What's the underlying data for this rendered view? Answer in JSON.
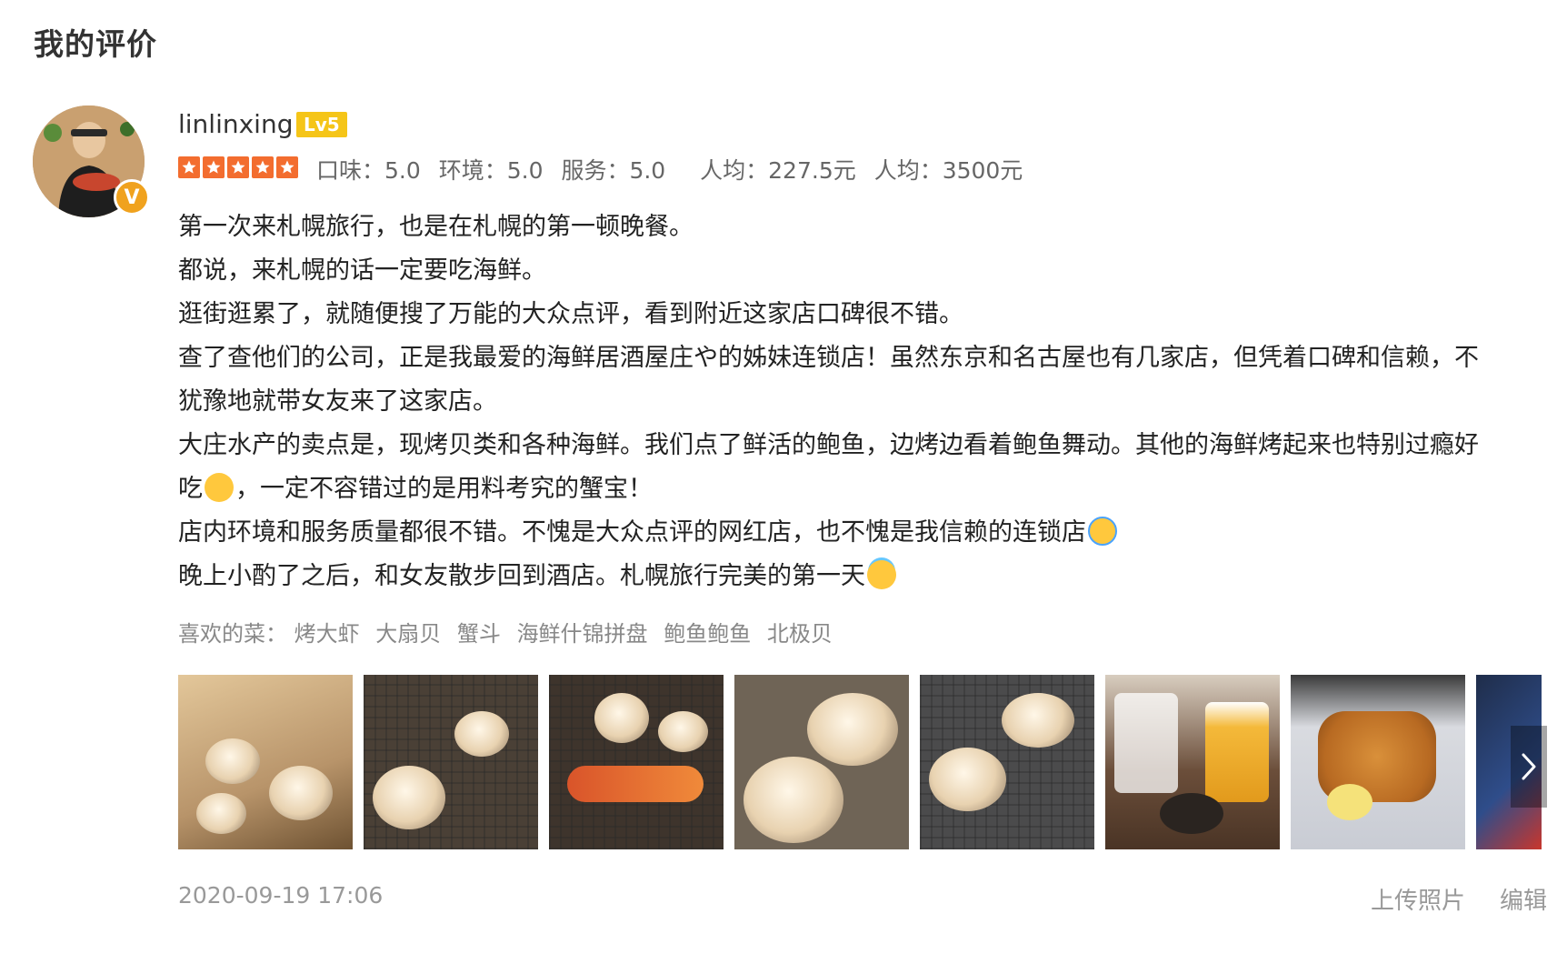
{
  "header": {
    "title": "我的评价"
  },
  "user": {
    "name": "linlinxing",
    "level": "Lv5",
    "verified_badge": "V"
  },
  "rating": {
    "stars": 5,
    "scores": [
      {
        "label": "口味：5.0"
      },
      {
        "label": "环境：5.0"
      },
      {
        "label": "服务：5.0"
      },
      {
        "label": "人均：227.5元"
      },
      {
        "label": "人均：3500元"
      }
    ]
  },
  "review": {
    "lines": [
      "第一次来札幌旅行，也是在札幌的第一顿晚餐。",
      "都说，来札幌的话一定要吃海鲜。",
      "逛街逛累了，就随便搜了万能的大众点评，看到附近这家店口碑很不错。",
      "查了查他们的公司，正是我最爱的海鲜居酒屋庄や的姊妹连锁店！虽然东京和名古屋也有几家店，但凭着口碑和信赖，不",
      "犹豫地就带女友来了这家店。",
      "大庄水产的卖点是，现烤贝类和各种海鲜。我们点了鲜活的鲍鱼，边烤边看着鲍鱼舞动。其他的海鲜烤起来也特别过瘾好",
      "吃",
      "，一定不容错过的是用料考究的蟹宝！",
      "店内环境和服务质量都很不错。不愧是大众点评的网红店，也不愧是我信赖的连锁店",
      "晚上小酌了之后，和女友散步回到酒店。札幌旅行完美的第一天"
    ]
  },
  "favorites": {
    "label": "喜欢的菜：",
    "dishes": [
      "烤大虾",
      "大扇贝",
      "蟹斗",
      "海鲜什锦拼盘",
      "鲍鱼鲍鱼",
      "北极贝"
    ]
  },
  "photos": {
    "icons": {
      "next": "chevron-right-icon"
    },
    "colors": [
      "#b8946a",
      "#6f6456",
      "#8a6a50",
      "#a59684",
      "#6c6d6e",
      "#6b4e3a",
      "#d9dbe0"
    ]
  },
  "footer": {
    "timestamp": "2020-09-19 17:06",
    "upload_label": "上传照片",
    "edit_label": "编辑"
  },
  "colors": {
    "star": "#f36d2f",
    "level_badge": "#f5c518",
    "verified_badge": "#f0a21e"
  }
}
